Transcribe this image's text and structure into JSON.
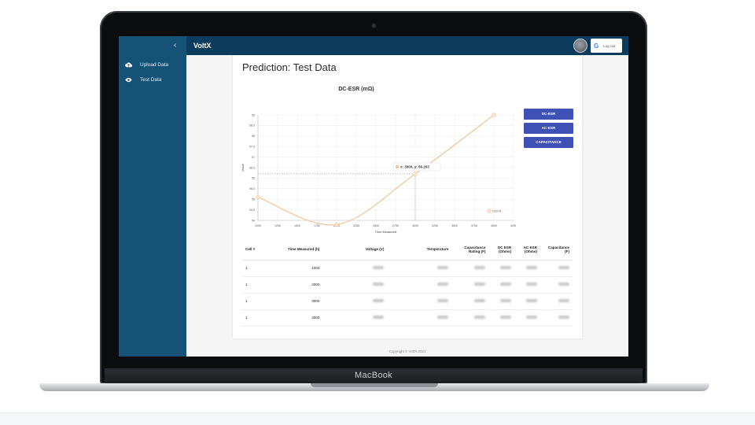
{
  "device": {
    "brand": "MacBook"
  },
  "app": {
    "logo": "VoltX",
    "collapse_glyph": "‹",
    "logout_label": "Log out",
    "google_glyph": "G",
    "footer": "Copyright © VoltX 2021"
  },
  "sidebar": {
    "items": [
      {
        "label": "Upload Data",
        "icon": "cloud-upload-icon"
      },
      {
        "label": "Test Data",
        "icon": "eye-icon"
      }
    ]
  },
  "page": {
    "title": "Prediction: Test Data"
  },
  "metric_buttons": [
    "DC-ESR",
    "AC-ESR",
    "CAPACITANCE"
  ],
  "tooltip": "x: 3000, y: 56.203",
  "chart_data": {
    "type": "line",
    "title": "DC-ESR (mΩ)",
    "xlabel": "Time Measured",
    "ylabel": "Value",
    "x_ticks": [
      "1000",
      "1250",
      "1500",
      "1750",
      "2000",
      "2250",
      "2500",
      "2750",
      "3000",
      "3250",
      "3500",
      "3750",
      "4000",
      "4250"
    ],
    "y_ticks": [
      "54",
      "54.5",
      "55",
      "55.5",
      "56",
      "56.5",
      "57",
      "57.5",
      "58",
      "58.5",
      "59"
    ],
    "xlim": [
      1000,
      4250
    ],
    "ylim": [
      54,
      59
    ],
    "series": [
      {
        "name": "Cell #1",
        "x": [
          1000,
          2000,
          3000,
          4000
        ],
        "y": [
          55.1,
          53.8,
          56.203,
          59.0
        ]
      }
    ],
    "legend": "bottom-right",
    "color": "#f2c89c",
    "grid": true
  },
  "table": {
    "headers": [
      "Cell #",
      "Time Measured (h)",
      "Voltage (V)",
      "Temperature",
      "Capacitance Rating (F)",
      "DC ESR (Ohms)",
      "AC ESR (Ohms)",
      "Capacitance (F)"
    ],
    "rows": [
      {
        "cell": "1",
        "time": "1000"
      },
      {
        "cell": "1",
        "time": "2000"
      },
      {
        "cell": "1",
        "time": "3000"
      },
      {
        "cell": "1",
        "time": "4000"
      }
    ]
  }
}
